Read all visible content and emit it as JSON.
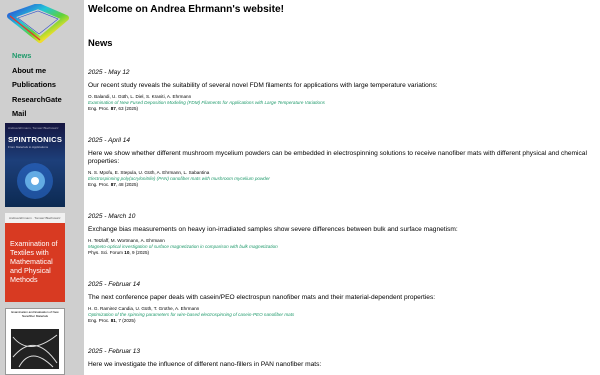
{
  "site_title": "Welcome on Andrea Ehrmann's website!",
  "news_heading": "News",
  "nav": [
    {
      "label": "News",
      "active": true
    },
    {
      "label": "About me",
      "active": false
    },
    {
      "label": "Publications",
      "active": false
    },
    {
      "label": "ResearchGate",
      "active": false
    },
    {
      "label": "Mail",
      "active": false
    }
  ],
  "books": [
    {
      "title": "SPINTRONICS",
      "publisher": "Andrea Ehrmann, Tomasz Blachowicz",
      "subtitle": "From Materials to Applications"
    },
    {
      "authors": "Andrea Ehrmann · Tomasz Blachowicz",
      "title": "Examination of Textiles with Mathematical and Physical Methods"
    },
    {
      "title": "Examination and Evaluation of New Nanofiber Materials"
    }
  ],
  "colors": {
    "sidebar_bg": "#cfcfcf",
    "accent": "#1f9a6b",
    "book2": "#d83a22"
  },
  "news": [
    {
      "date": "2025 - May 12",
      "text": "Our recent study reveals the suitability of several novel FDM filaments for applications with large temperature variations:",
      "authors": "O. Balandi, U. Güth, L. Diel, S. Kraniti, A. Ehrmann",
      "paper": "Examination of New Fused Deposition Modeling (FDM) Filaments for Applications with Large Temperature Variations",
      "journal": "Eng. Proc.",
      "volume": "87",
      "pages": ", 63 (2025)"
    },
    {
      "date": "2025 - April 14",
      "text": "Here we show whether different mushroom mycelium powders can be embedded in electrospinning solutions to receive nanofiber mats with different physical and chemical properties:",
      "authors": "N. S. Mpofu, E. Stepula, U. Güth, A. Ehrmann, L. Sabantina",
      "paper": "Electrospinning poly(acrylonitrile) (PAN) nanofiber mats with mushroom mycelium powder",
      "journal": "Eng. Proc.",
      "volume": "87",
      "pages": ", 48 (2025)"
    },
    {
      "date": "2025 - March 10",
      "text": "Exchange bias measurements on heavy ion-irradiated samples show severe differences between bulk and surface magnetism:",
      "authors": "H. Tetzlaff, M. Wortmann, A. Ehrmann",
      "paper": "Magneto-optical investigation of surface magnetization in comparison with bulk magnetization",
      "journal": "Phys. Sci. Forum",
      "volume": "10",
      "pages": ", 9 (2025)"
    },
    {
      "date": "2025 - Februar 14",
      "text": "The next conference paper deals with casein/PEO electrospun nanofiber mats and their material-dependent properties:",
      "authors": "H. G. Ramirez Candia, U. Güth, T. Grothe, A. Ehrmann",
      "paper": "Optimization of the spinning parameters for wire-based electrospinning of casein-PEO nanofiber mats",
      "journal": "Eng. Proc.",
      "volume": "81",
      "pages": ", 7 (2025)"
    },
    {
      "date": "2025 - Februar 13",
      "text": "Here we investigate the influence of different nano-fillers in PAN nanofiber mats:"
    }
  ]
}
